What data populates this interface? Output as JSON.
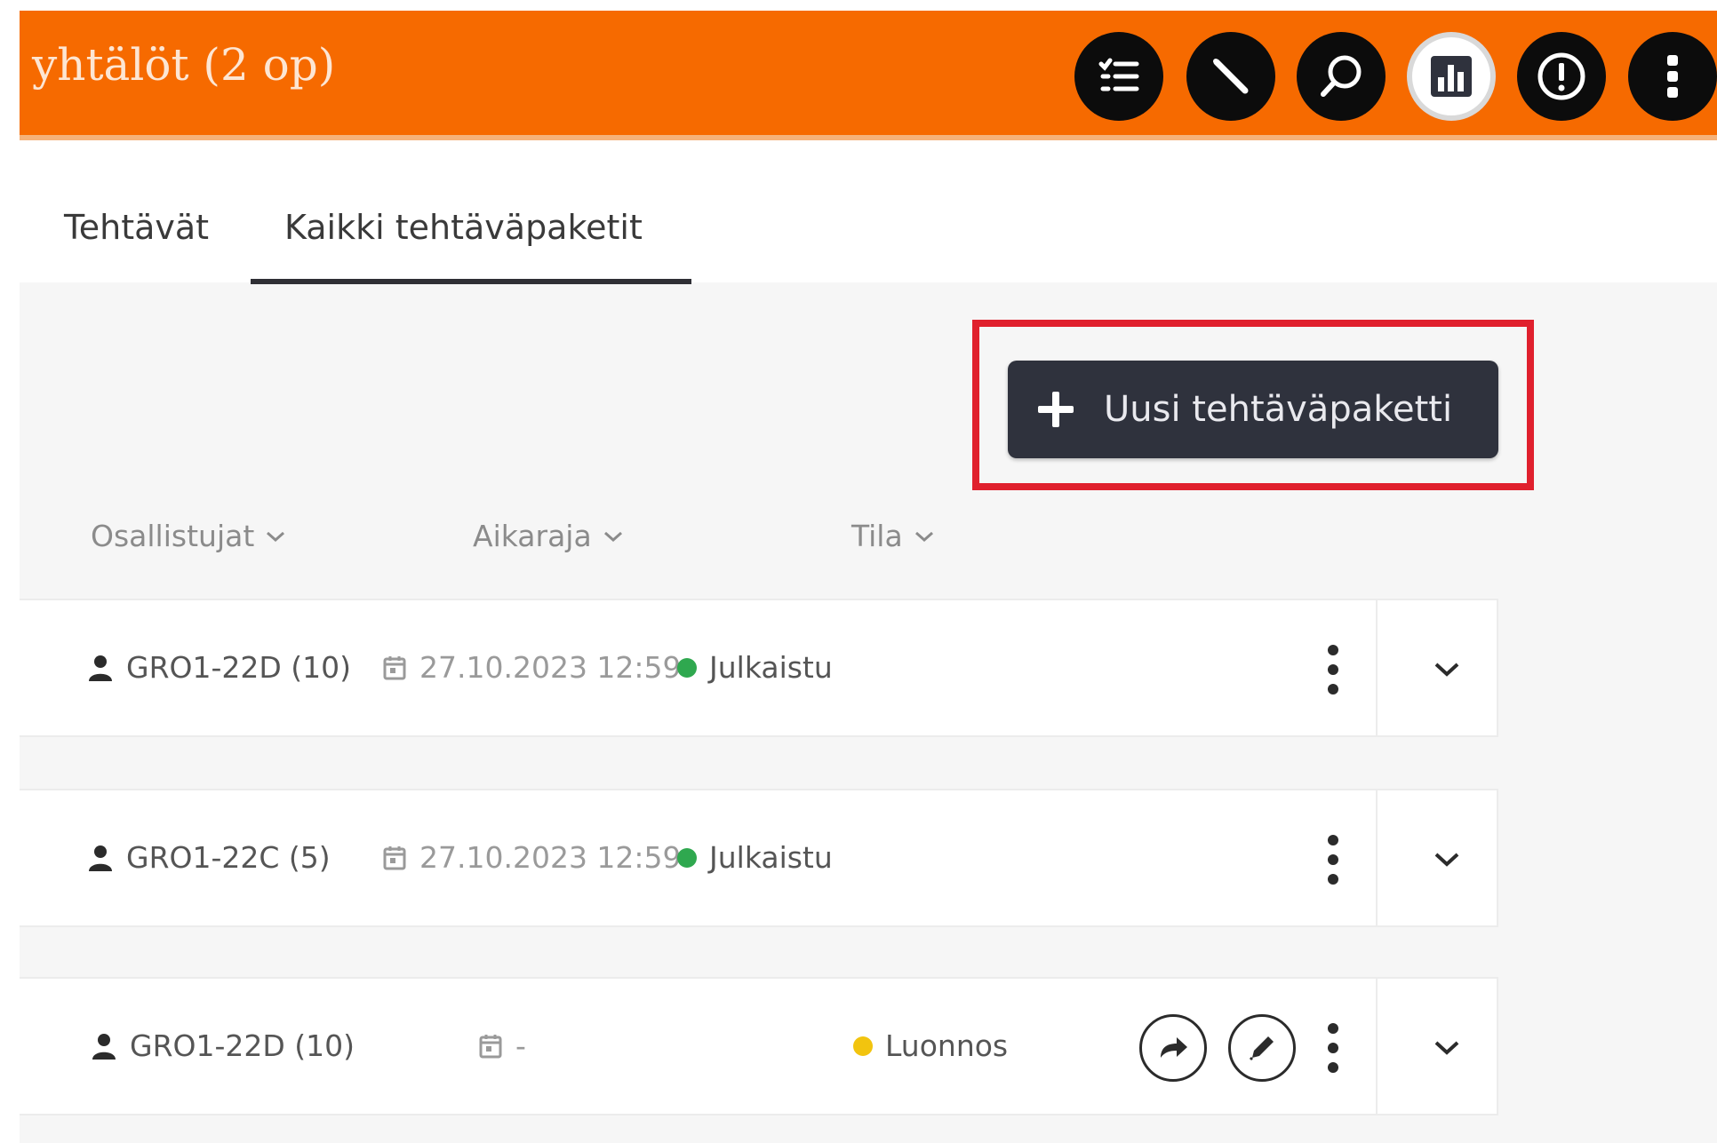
{
  "header": {
    "title": "yhtälöt (2 op)",
    "color": "#f66a00",
    "buttons": [
      {
        "icon": "checklist-icon"
      },
      {
        "icon": "pen-icon"
      },
      {
        "icon": "search-icon"
      },
      {
        "icon": "chart-icon",
        "active": true
      },
      {
        "icon": "alert-icon"
      },
      {
        "icon": "more-vertical-icon"
      }
    ]
  },
  "tabs": [
    {
      "label": "Tehtävät",
      "selected": false
    },
    {
      "label": "Kaikki tehtäväpaketit",
      "selected": true
    }
  ],
  "new_button": {
    "label": "Uusi tehtäväpaketti",
    "icon": "plus-icon",
    "highlight_color": "#e0202d"
  },
  "columns": [
    {
      "label": "Osallistujat"
    },
    {
      "label": "Aikaraja"
    },
    {
      "label": "Tila"
    }
  ],
  "rows": [
    {
      "participants": "GRO1-22D (10)",
      "deadline": "27.10.2023  12:59",
      "status": "Julkaistu",
      "status_color": "#2fa84f",
      "actions": false
    },
    {
      "participants": "GRO1-22C (5)",
      "deadline": "27.10.2023  12:59",
      "status": "Julkaistu",
      "status_color": "#2fa84f",
      "actions": false
    },
    {
      "participants": "GRO1-22D (10)",
      "deadline": "-",
      "status": "Luonnos",
      "status_color": "#f2c40f",
      "actions": true
    }
  ]
}
